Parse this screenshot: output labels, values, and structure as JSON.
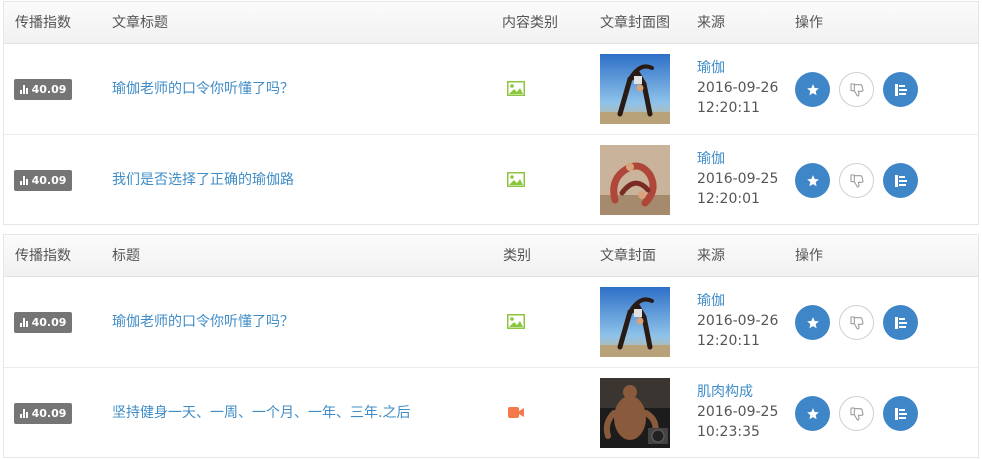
{
  "tables": [
    {
      "headers": [
        "传播指数",
        "文章标题",
        "内容类别",
        "文章封面图",
        "来源",
        "操作"
      ],
      "rows": [
        {
          "score": "40.09",
          "title": "瑜伽老师的口令你听懂了吗？",
          "category": "image",
          "cover": "yoga-pose-cover",
          "source": "瑜伽",
          "date": "2016-09-26",
          "time": "12:20:11"
        },
        {
          "score": "40.09",
          "title": "我们是否选择了正确的瑜伽路",
          "category": "image",
          "cover": "yoga-couple-cover",
          "source": "瑜伽",
          "date": "2016-09-25",
          "time": "12:20:01"
        }
      ]
    },
    {
      "headers": [
        "传播指数",
        "标题",
        "类别",
        "文章封面",
        "来源",
        "操作"
      ],
      "rows": [
        {
          "score": "40.09",
          "title": "瑜伽老师的口令你听懂了吗？",
          "category": "image",
          "cover": "yoga-pose-cover",
          "source": "瑜伽",
          "date": "2016-09-26",
          "time": "12:20:11"
        },
        {
          "score": "40.09",
          "title": "坚持健身一天、一周、一个月、一年、三年.之后",
          "category": "video",
          "cover": "bodybuilder-cover",
          "source": "肌肉构成",
          "date": "2016-09-25",
          "time": "10:23:35"
        }
      ]
    }
  ],
  "colors": {
    "link": "#3f8cc7",
    "action_blue": "#3f86c8",
    "image_icon": "#8cc63f",
    "video_icon": "#f5784a",
    "badge": "#757575"
  }
}
